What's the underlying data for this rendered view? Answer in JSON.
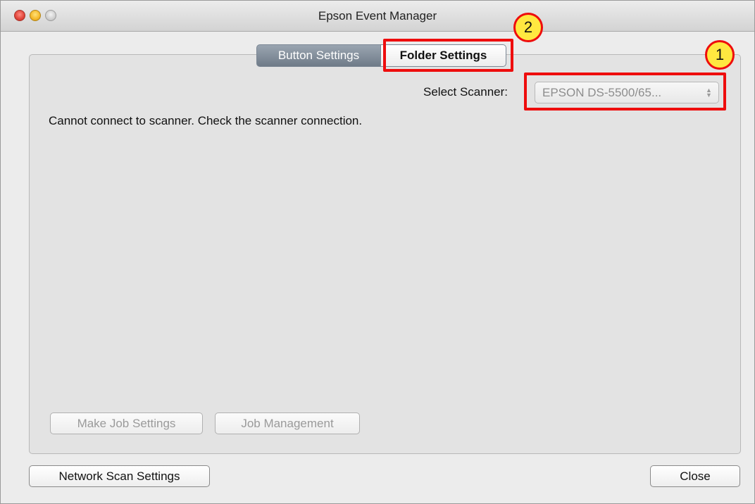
{
  "window": {
    "title": "Epson Event Manager"
  },
  "tabs": [
    {
      "label": "Button Settings",
      "selected": true
    },
    {
      "label": "Folder Settings",
      "selected": false
    }
  ],
  "scanner": {
    "label": "Select Scanner:",
    "value": "EPSON DS-5500/65...",
    "arrows": "▲▼"
  },
  "message": "Cannot connect to scanner. Check the scanner connection.",
  "buttons": {
    "make_job": "Make Job Settings",
    "job_management": "Job Management",
    "network_scan": "Network Scan Settings",
    "close": "Close"
  },
  "annotations": [
    {
      "number": "1"
    },
    {
      "number": "2"
    }
  ],
  "colors": {
    "annotation_red": "#ee0d0d",
    "badge_yellow": "#ffe840"
  }
}
